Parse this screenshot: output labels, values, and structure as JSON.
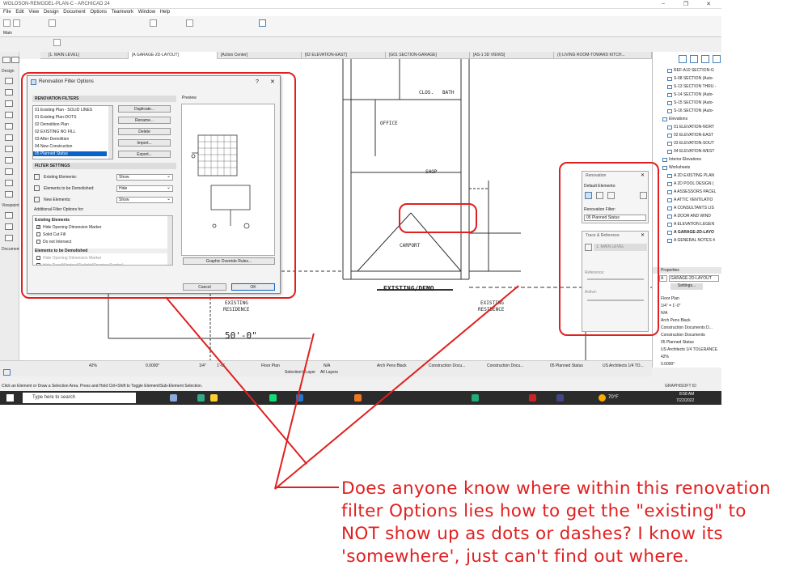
{
  "window": {
    "title": "WOLOSON-REMODEL-PLAN-C - ARCHICAD 24",
    "minimize": "–",
    "maximize": "❐",
    "close": "✕"
  },
  "menu": [
    "File",
    "Edit",
    "View",
    "Design",
    "Document",
    "Options",
    "Teamwork",
    "Window",
    "Help"
  ],
  "toolbox": {
    "design": "Design",
    "viewpoint": "Viewpoint",
    "document": "Document",
    "main": "Main"
  },
  "tabs": [
    "[1. MAIN LEVEL]",
    "[A GARAGE-2D-LAYOUT]",
    "[Action Center]",
    "[02 ELEVATION-EAST]",
    "[G01 SECTION-GARAGE]",
    "[AS-1 3D VIEWS]",
    "(I) LIVING ROOM-TOWARD KITCH..."
  ],
  "drawing": {
    "rooms": [
      "CLOS.",
      "BATH",
      "OFFICE",
      "SHOP",
      "CARPORT"
    ],
    "existing_demo": "EXISTING/DEMO",
    "existing_residence_left": [
      "EXISTING",
      "RESIDENCE"
    ],
    "existing_residence_right": [
      "EXISTING",
      "RESIDENCE"
    ],
    "dimension": "50'-0\""
  },
  "dialog": {
    "title": "Renovation Filter Options",
    "help": "?",
    "close": "✕",
    "filters_heading": "RENOVATION FILTERS",
    "filters": [
      "01 Existing Plan - SOLID LINES",
      "01 Existing Plan-DOTS",
      "02 Demolition Plan",
      "02 EXISTING NO FILL",
      "03 After Demolition",
      "04 New Construction",
      "05 Planned Status"
    ],
    "selected_filter_index": 6,
    "buttons": [
      "Duplicate...",
      "Rename...",
      "Delete",
      "Import...",
      "Export..."
    ],
    "settings_heading": "FILTER SETTINGS",
    "settings": [
      {
        "label": "Existing Elements:",
        "value": "Show"
      },
      {
        "label": "Elements to be Demolished:",
        "value": "Hide"
      },
      {
        "label": "New Elements:",
        "value": "Show"
      }
    ],
    "additional": "Additional Filter Options for:",
    "existing_group": "Existing Elements",
    "existing_options": [
      {
        "label": "Hide Opening Dimension Marker",
        "checked": true
      },
      {
        "label": "Solid Cut Fill",
        "checked": false
      },
      {
        "label": "Do not Intersect",
        "checked": false
      }
    ],
    "demolished_group": "Elements to be Demolished",
    "demolished_options": [
      "Hide Opening Dimension Marker",
      "Hide Door/Window/Skylight/Opening Symbol"
    ],
    "preview_label": "Preview",
    "graphic_override": "Graphic Override Rules...",
    "cancel": "Cancel",
    "ok": "OK"
  },
  "navigator": {
    "items": [
      "REF-A10 SECTION-G",
      "S-08 SECTION (Auto-",
      "S-13 SECTION THRU -",
      "S-14 SECTION (Auto-",
      "S-15 SECTION (Auto-",
      "S-16 SECTION (Auto-",
      "Elevations",
      "01 ELEVATION-NORT",
      "02 ELEVATION-EAST",
      "03 ELEVATION-SOUT",
      "04 ELEVATION-WEST",
      "Interior Elevations",
      "Worksheets",
      "A 2D EXISTING PLAN",
      "A 2D POOL DESIGN (",
      "A ASSESSORS PACEL",
      "A ATTIC VENTILATIO",
      "A CONSULTANTS LIS",
      "A DOOR AND WIND",
      "A ELEVATION LEGEN",
      "A GARAGE-2D-LAYO",
      "A GENERAL NOTES 4"
    ],
    "properties": "Properties",
    "prop_id": "A",
    "prop_name": "GARAGE-2D-LAYOUT",
    "settings": "Settings...",
    "prop_list": [
      "Floor Plan",
      "1/4\"  =  1'-0\"",
      "N/A",
      "Arch Pens Black",
      "Construction Documents D...",
      "Construction Documents",
      "05 Planned Status",
      "US Architects 1/4 TOLERANCE",
      "42%",
      "0.0000°"
    ]
  },
  "renovation_palette": {
    "title": "Renovation",
    "default_elements": "Default Elements:",
    "filter_label": "Renovation Filter:",
    "filter_value": "05 Planned Status"
  },
  "trace_palette": {
    "title": "Trace & Reference",
    "level": "1. MAIN LEVEL",
    "reference": "Reference:",
    "active": "Active:"
  },
  "statusbar": [
    "42%",
    "0.0000°",
    "1/4\"",
    "1'-0\"",
    "Floor Plan",
    "N/A",
    "Selection's Layer",
    "All Layers",
    "Arch Pens Black",
    "Construction Docu...",
    "Construction Docu...",
    "05 Planned Status",
    "US Architects 1/4 TO..."
  ],
  "hint": "Click an Element or Draw a Selection Area. Press and Hold Ctrl+Shift to Toggle Element/Sub-Element Selection.",
  "taskbar": {
    "search": "Type here to search",
    "weather": "70°F",
    "time": "8:58 AM",
    "date": "7/22/2022",
    "logo": "GRAPHISOFT ID"
  },
  "comment_lines": [
    "Does anyone know where within this renovation",
    "filter Options lies how to get the \"existing\" to",
    "NOT show up as dots or dashes? I know its",
    "'somewhere', just can't find out where."
  ],
  "colors": {
    "annotation": "#e02020",
    "selection": "#0a64c8"
  }
}
